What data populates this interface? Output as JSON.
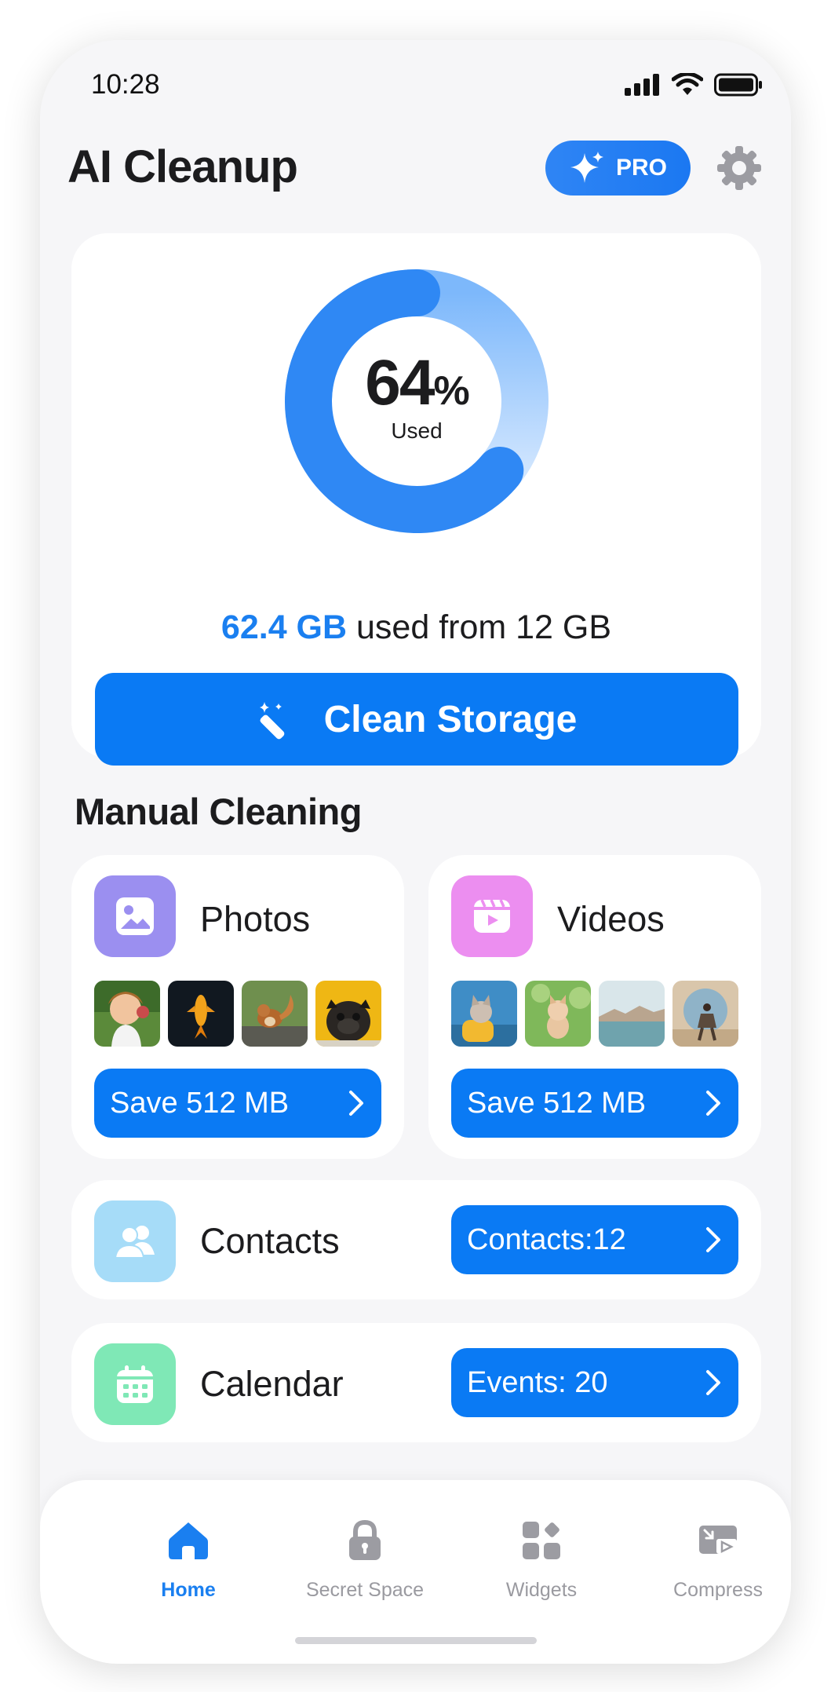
{
  "status_bar": {
    "time": "10:28"
  },
  "header": {
    "title": "AI Cleanup",
    "pro_label": "PRO"
  },
  "storage": {
    "percent": "64",
    "percent_value": 0.64,
    "percent_sign": "%",
    "used_label": "Used",
    "used_amount": "62.4 GB",
    "used_suffix": " used from 12 GB",
    "clean_button": "Clean Storage"
  },
  "manual": {
    "title": "Manual Cleaning",
    "photos": {
      "label": "Photos",
      "save": "Save 512 MB"
    },
    "videos": {
      "label": "Videos",
      "save": "Save 512 MB"
    },
    "contacts": {
      "label": "Contacts",
      "button": "Contacts:12"
    },
    "calendar": {
      "label": "Calendar",
      "button": "Events: 20"
    }
  },
  "tabs": [
    {
      "label": "Home",
      "icon": "home-icon",
      "active": true
    },
    {
      "label": "Secret Space",
      "icon": "lock-icon"
    },
    {
      "label": "Widgets",
      "icon": "widgets-icon"
    },
    {
      "label": "Compress",
      "icon": "compress-icon"
    }
  ],
  "colors": {
    "accent": "#0a7af4",
    "photos_icon": "#9b8ff0",
    "videos_icon": "#ec8ef0",
    "contacts_icon": "#a6dcf8",
    "calendar_icon": "#7fe8b6"
  }
}
